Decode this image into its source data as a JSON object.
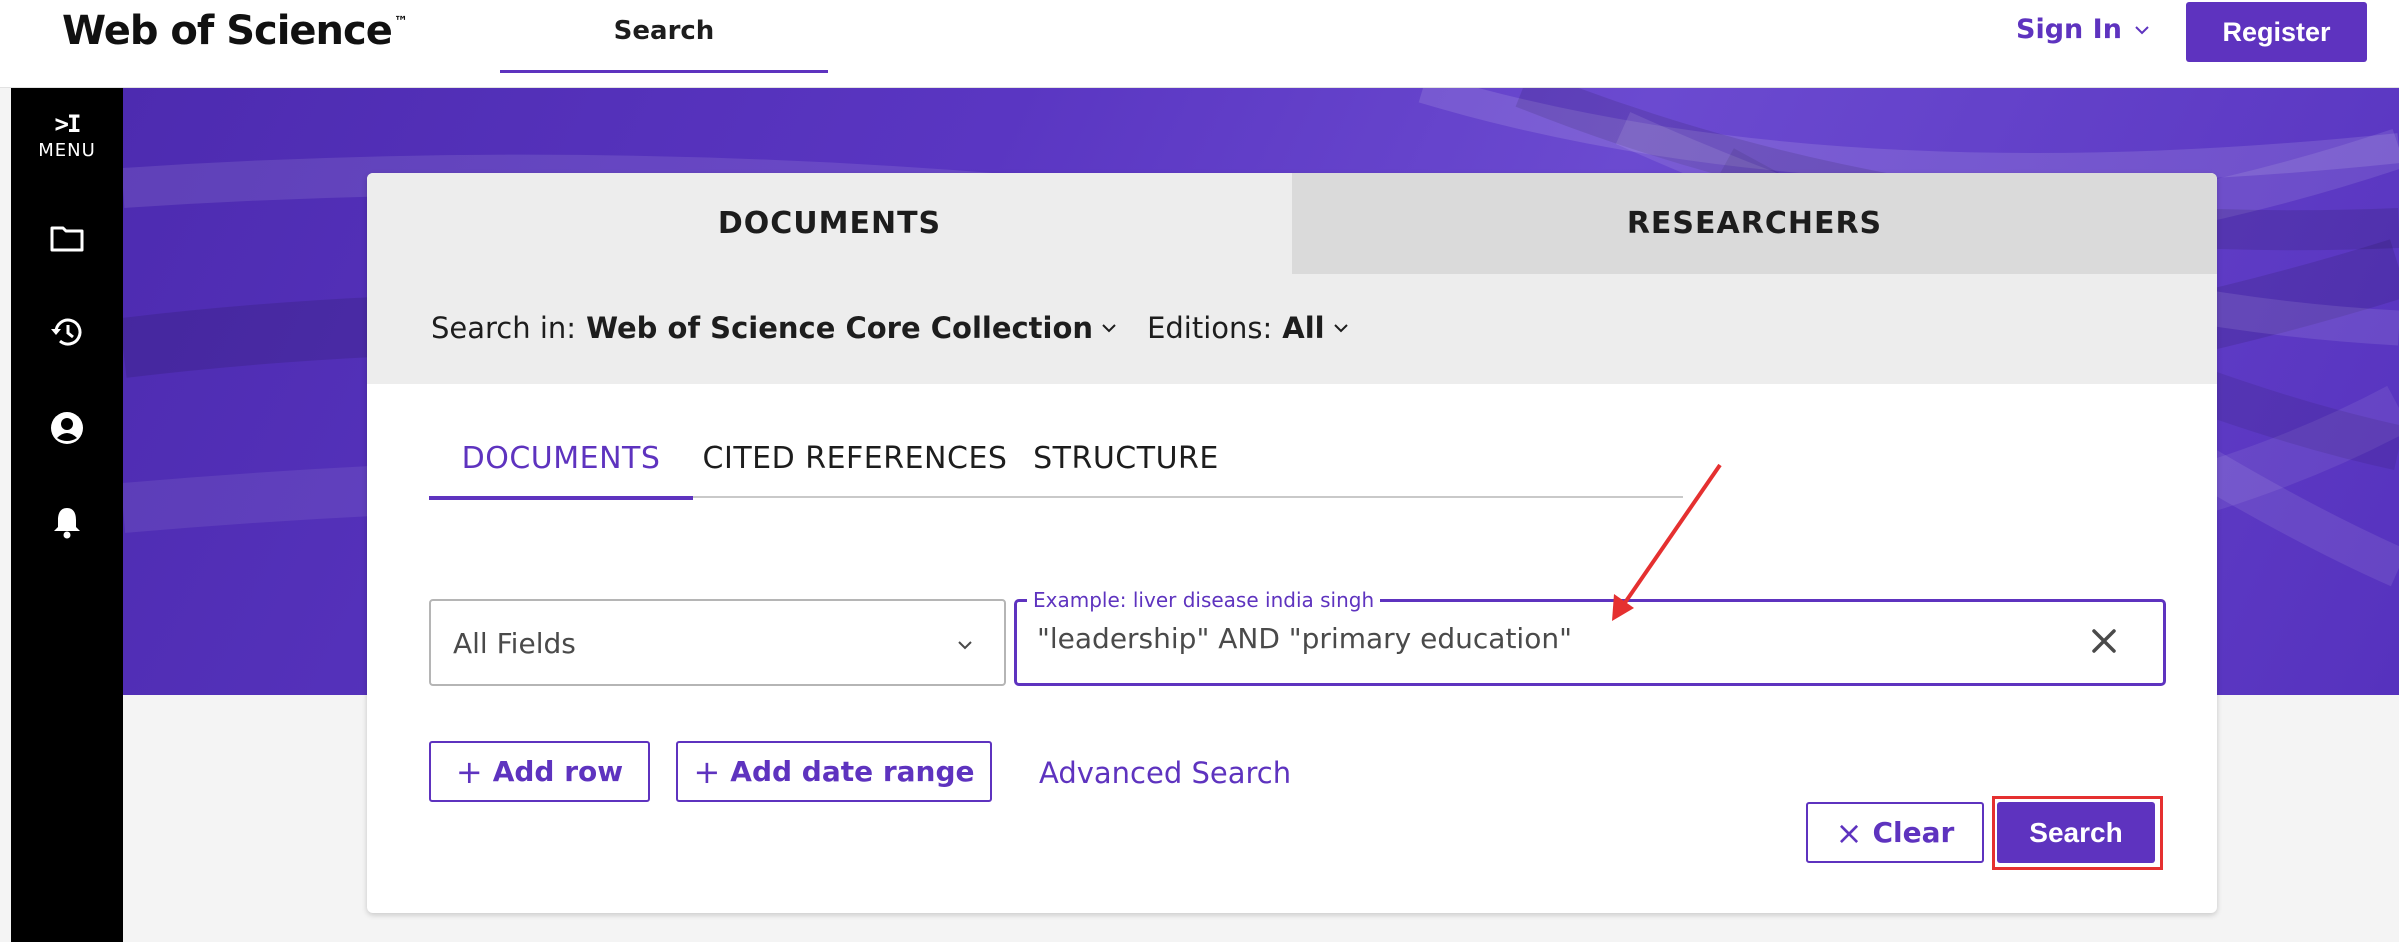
{
  "header": {
    "logo_text": "Web of Science",
    "logo_mark": "™",
    "nav_search_label": "Search",
    "signin_label": "Sign In",
    "register_label": "Register"
  },
  "sidebar": {
    "expand_glyph": ">I",
    "menu_label": "MENU",
    "icons": [
      "folder-icon",
      "history-icon",
      "account-icon",
      "notification-bell-icon"
    ]
  },
  "card": {
    "tabs": [
      {
        "label": "DOCUMENTS",
        "active": true
      },
      {
        "label": "RESEARCHERS",
        "active": false
      }
    ],
    "search_in_label": "Search in:",
    "search_in_value": "Web of Science Core Collection",
    "editions_label": "Editions:",
    "editions_value": "All",
    "subtabs": [
      {
        "label": "DOCUMENTS",
        "active": true
      },
      {
        "label": "CITED REFERENCES",
        "active": false
      },
      {
        "label": "STRUCTURE",
        "active": false
      }
    ],
    "field_select_value": "All Fields",
    "query_example_label": "Example: liver disease india singh",
    "query_value": "\"leadership\" AND \"primary education\"",
    "add_row_label": "Add row",
    "add_date_range_label": "Add date range",
    "plus_glyph": "+",
    "advanced_search_label": "Advanced Search",
    "clear_glyph": "×",
    "clear_label": "Clear",
    "search_label": "Search"
  },
  "colors": {
    "brand_purple": "#5e33bf",
    "annotation_red": "#e53030"
  }
}
